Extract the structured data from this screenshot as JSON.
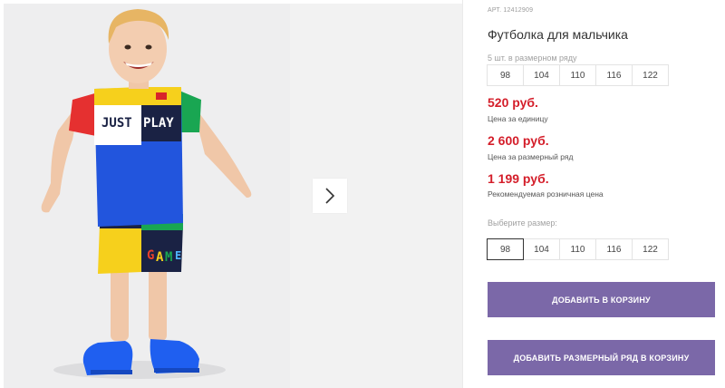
{
  "gallery": {
    "next_icon": "chevron-right-icon"
  },
  "product": {
    "article": "АРТ. 12412909",
    "title": "Футболка для мальчика",
    "pack_note": "5 шт. в размерном ряду",
    "pack_sizes": [
      "98",
      "104",
      "110",
      "116",
      "122"
    ],
    "prices": [
      {
        "value": "520 руб.",
        "label": "Цена за единицу"
      },
      {
        "value": "2 600 руб.",
        "label": "Цена за размерный ряд"
      },
      {
        "value": "1 199 руб.",
        "label": "Рекомендуемая розничная цена"
      }
    ],
    "choose_size_label": "Выберите размер:",
    "sizes": [
      "98",
      "104",
      "110",
      "116",
      "122"
    ],
    "selected_size": "98"
  },
  "actions": {
    "add_to_cart": "ДОБАВИТЬ В КОРЗИНУ",
    "add_pack_to_cart": "ДОБАВИТЬ РАЗМЕРНЫЙ РЯД В КОРЗИНУ"
  },
  "colors": {
    "price": "#d41e2a",
    "button": "#7b68a8"
  }
}
